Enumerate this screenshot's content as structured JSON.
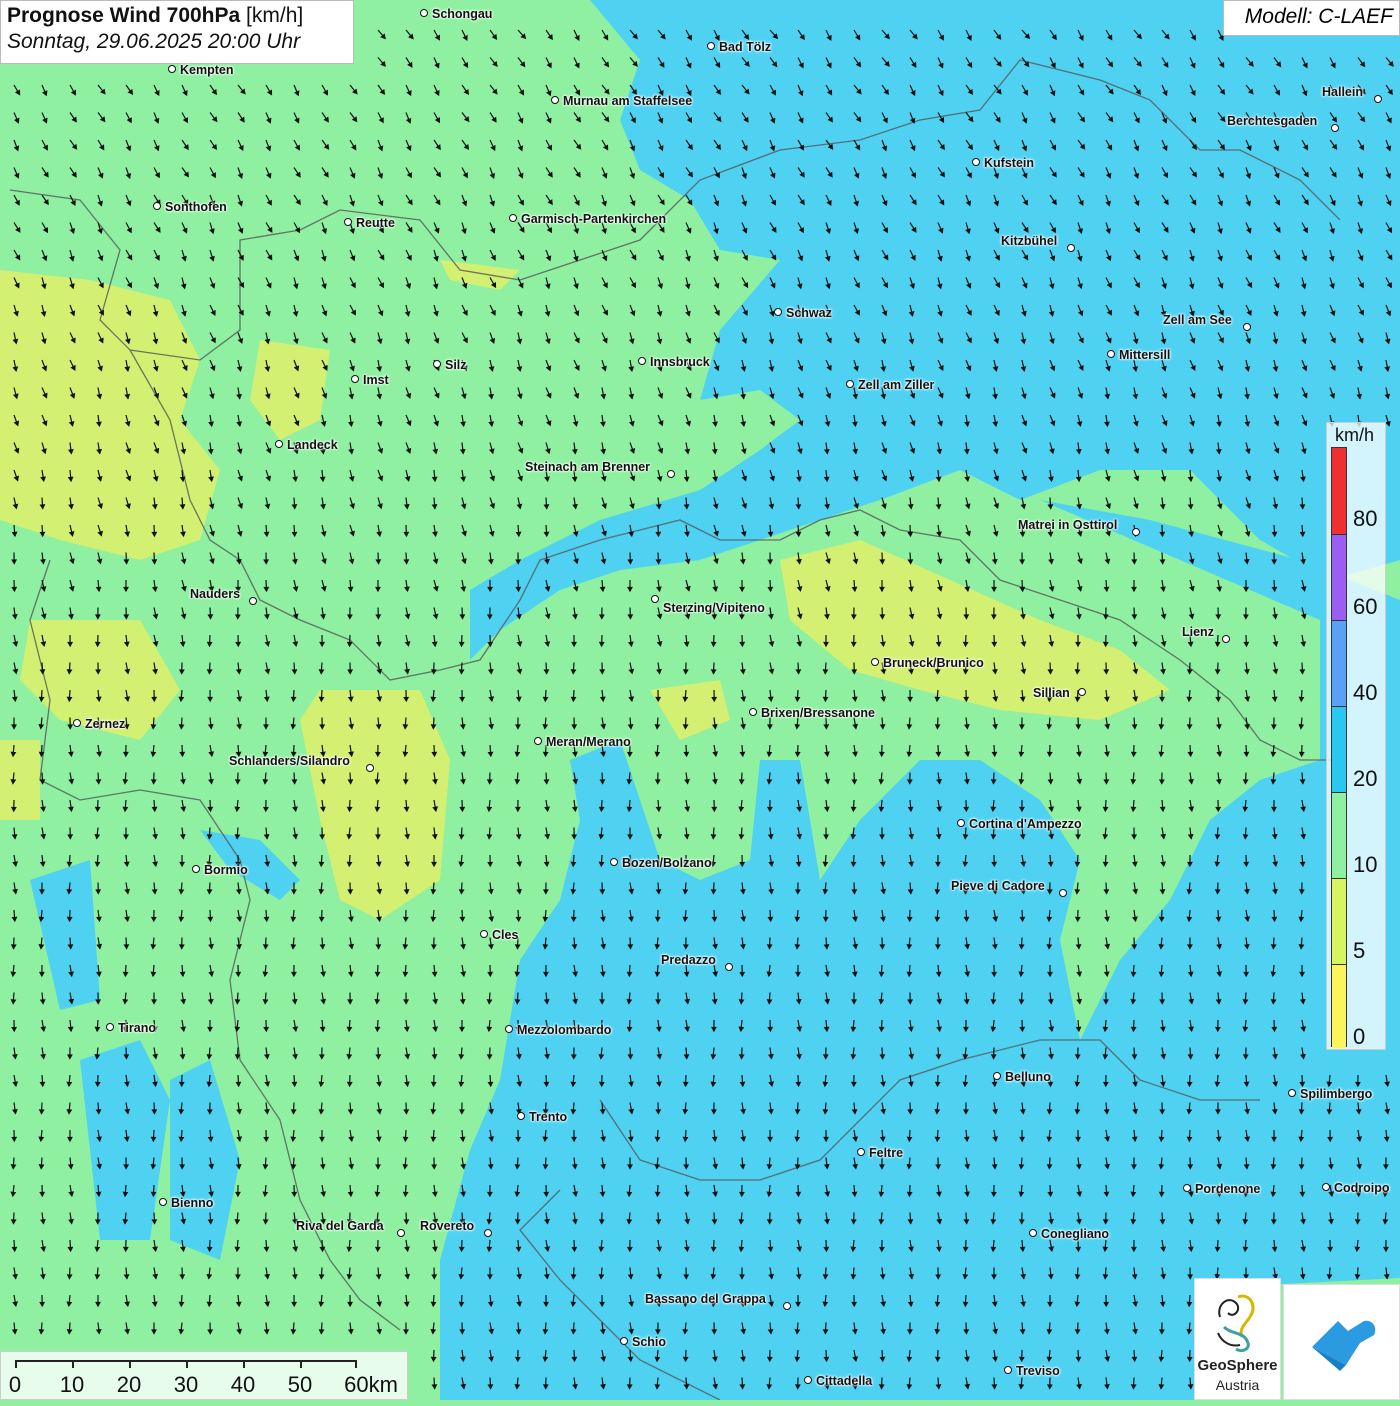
{
  "title": {
    "main": "Prognose Wind 700hPa",
    "unit": "[km/h]",
    "datetime": "Sonntag, 29.06.2025 20:00 Uhr"
  },
  "model": "Modell: C-LAEF",
  "legend": {
    "unit": "km/h",
    "labels": [
      "80",
      "60",
      "40",
      "20",
      "10",
      "5",
      "0"
    ],
    "colors": [
      "#f03030",
      "#9a5ef0",
      "#5aa0f5",
      "#28c8f0",
      "#8ef0a0",
      "#d6f560",
      "#fbf45a"
    ]
  },
  "scale": {
    "labels": [
      "0",
      "10",
      "20",
      "30",
      "40",
      "50",
      "60km"
    ]
  },
  "logos": {
    "geosphere_line1": "GeoSphere",
    "geosphere_line2": "Austria"
  },
  "cities": [
    {
      "name": "Schongau"
    },
    {
      "name": "Bad Tölz"
    },
    {
      "name": "Kempten"
    },
    {
      "name": "Murnau am Staffelsee"
    },
    {
      "name": "Hallein"
    },
    {
      "name": "Berchtesgaden"
    },
    {
      "name": "Kufstein"
    },
    {
      "name": "Sonthofen"
    },
    {
      "name": "Reutte"
    },
    {
      "name": "Garmisch-Partenkirchen"
    },
    {
      "name": "Kitzbühel"
    },
    {
      "name": "Schwaz"
    },
    {
      "name": "Zell am See"
    },
    {
      "name": "Mittersill"
    },
    {
      "name": "Silz"
    },
    {
      "name": "Innsbruck"
    },
    {
      "name": "Imst"
    },
    {
      "name": "Zell am Ziller"
    },
    {
      "name": "Landeck"
    },
    {
      "name": "Steinach am Brenner"
    },
    {
      "name": "Matrei in Osttirol"
    },
    {
      "name": "Nauders"
    },
    {
      "name": "Sterzing/Vipiteno"
    },
    {
      "name": "Lienz"
    },
    {
      "name": "Bruneck/Brunico"
    },
    {
      "name": "Sillian"
    },
    {
      "name": "Brixen/Bressanone"
    },
    {
      "name": "Zernez"
    },
    {
      "name": "Meran/Merano"
    },
    {
      "name": "Schlanders/Silandro"
    },
    {
      "name": "Cortina d'Ampezzo"
    },
    {
      "name": "Bozen/Bolzano"
    },
    {
      "name": "Bormio"
    },
    {
      "name": "Pieve di Cadore"
    },
    {
      "name": "Cles"
    },
    {
      "name": "Predazzo"
    },
    {
      "name": "Tirano"
    },
    {
      "name": "Mezzolombardo"
    },
    {
      "name": "Belluno"
    },
    {
      "name": "Spilimbergo"
    },
    {
      "name": "Trento"
    },
    {
      "name": "Feltre"
    },
    {
      "name": "Pordenone"
    },
    {
      "name": "Codroipo"
    },
    {
      "name": "Bienno"
    },
    {
      "name": "Riva del Garda"
    },
    {
      "name": "Rovereto"
    },
    {
      "name": "Conegliano"
    },
    {
      "name": "Bassano del Grappa"
    },
    {
      "name": "Schio"
    },
    {
      "name": "Treviso"
    },
    {
      "name": "Cittadella"
    }
  ]
}
